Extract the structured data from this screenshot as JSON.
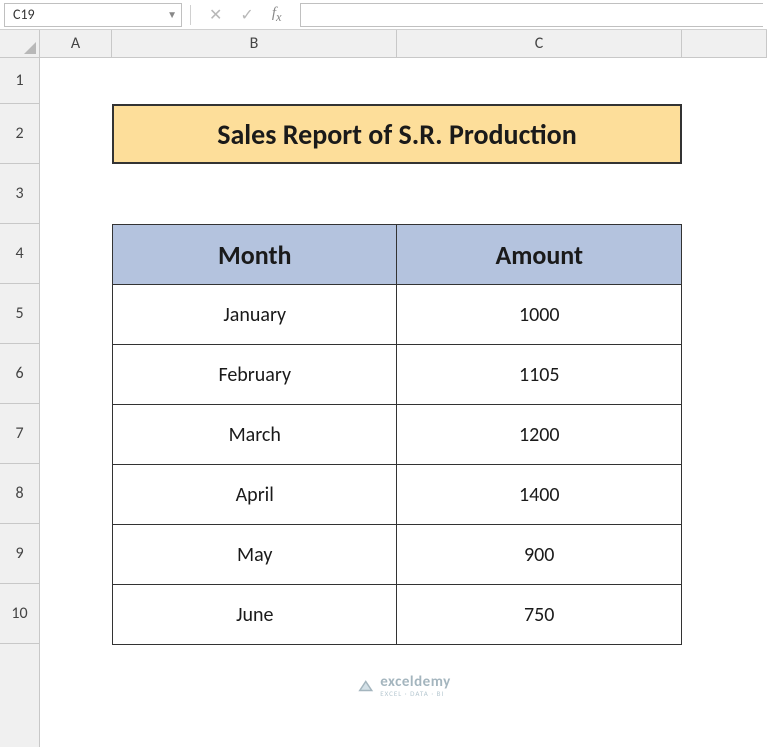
{
  "nameBox": {
    "value": "C19"
  },
  "formulaBar": {
    "value": ""
  },
  "columns": [
    "A",
    "B",
    "C"
  ],
  "rows": [
    "1",
    "2",
    "3",
    "4",
    "5",
    "6",
    "7",
    "8",
    "9",
    "10"
  ],
  "title": "Sales Report of S.R. Production",
  "table": {
    "headers": {
      "col1": "Month",
      "col2": "Amount"
    },
    "rows": [
      {
        "month": "January",
        "amount": "1000"
      },
      {
        "month": "February",
        "amount": "1105"
      },
      {
        "month": "March",
        "amount": "1200"
      },
      {
        "month": "April",
        "amount": "1400"
      },
      {
        "month": "May",
        "amount": "900"
      },
      {
        "month": "June",
        "amount": "750"
      }
    ]
  },
  "watermark": {
    "brand": "exceldemy",
    "tagline": "EXCEL · DATA · BI"
  },
  "chart_data": {
    "type": "table",
    "title": "Sales Report of S.R. Production",
    "columns": [
      "Month",
      "Amount"
    ],
    "rows": [
      [
        "January",
        1000
      ],
      [
        "February",
        1105
      ],
      [
        "March",
        1200
      ],
      [
        "April",
        1400
      ],
      [
        "May",
        900
      ],
      [
        "June",
        750
      ]
    ]
  }
}
